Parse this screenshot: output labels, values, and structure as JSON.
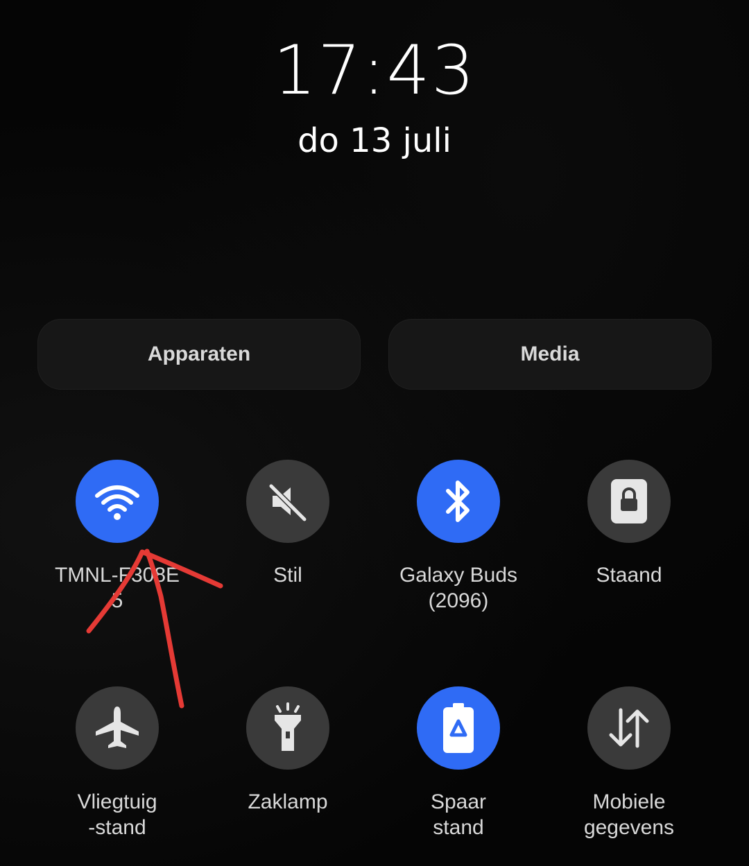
{
  "lockscreen": {
    "time": "17:43",
    "date": "do 13 juli"
  },
  "panel_buttons": {
    "devices": "Apparaten",
    "media": "Media"
  },
  "quick_settings": [
    {
      "label": "TMNL-F308E\n5",
      "icon": "wifi-icon",
      "state": "on"
    },
    {
      "label": "Stil",
      "icon": "mute-icon",
      "state": "off"
    },
    {
      "label": "Galaxy Buds\n(2096)",
      "icon": "bluetooth-icon",
      "state": "on"
    },
    {
      "label": "Staand",
      "icon": "portrait-lock-icon",
      "state": "off"
    },
    {
      "label": "Vliegtuig\n-stand",
      "icon": "airplane-icon",
      "state": "off"
    },
    {
      "label": "Zaklamp",
      "icon": "flashlight-icon",
      "state": "off"
    },
    {
      "label": "Spaar\nstand",
      "icon": "power-saving-icon",
      "state": "on"
    },
    {
      "label": "Mobiele\ngegevens",
      "icon": "mobile-data-icon",
      "state": "off"
    }
  ],
  "colors": {
    "active": "#2f6bf5",
    "inactive": "#3a3a3a",
    "annotation": "#e53a35"
  }
}
